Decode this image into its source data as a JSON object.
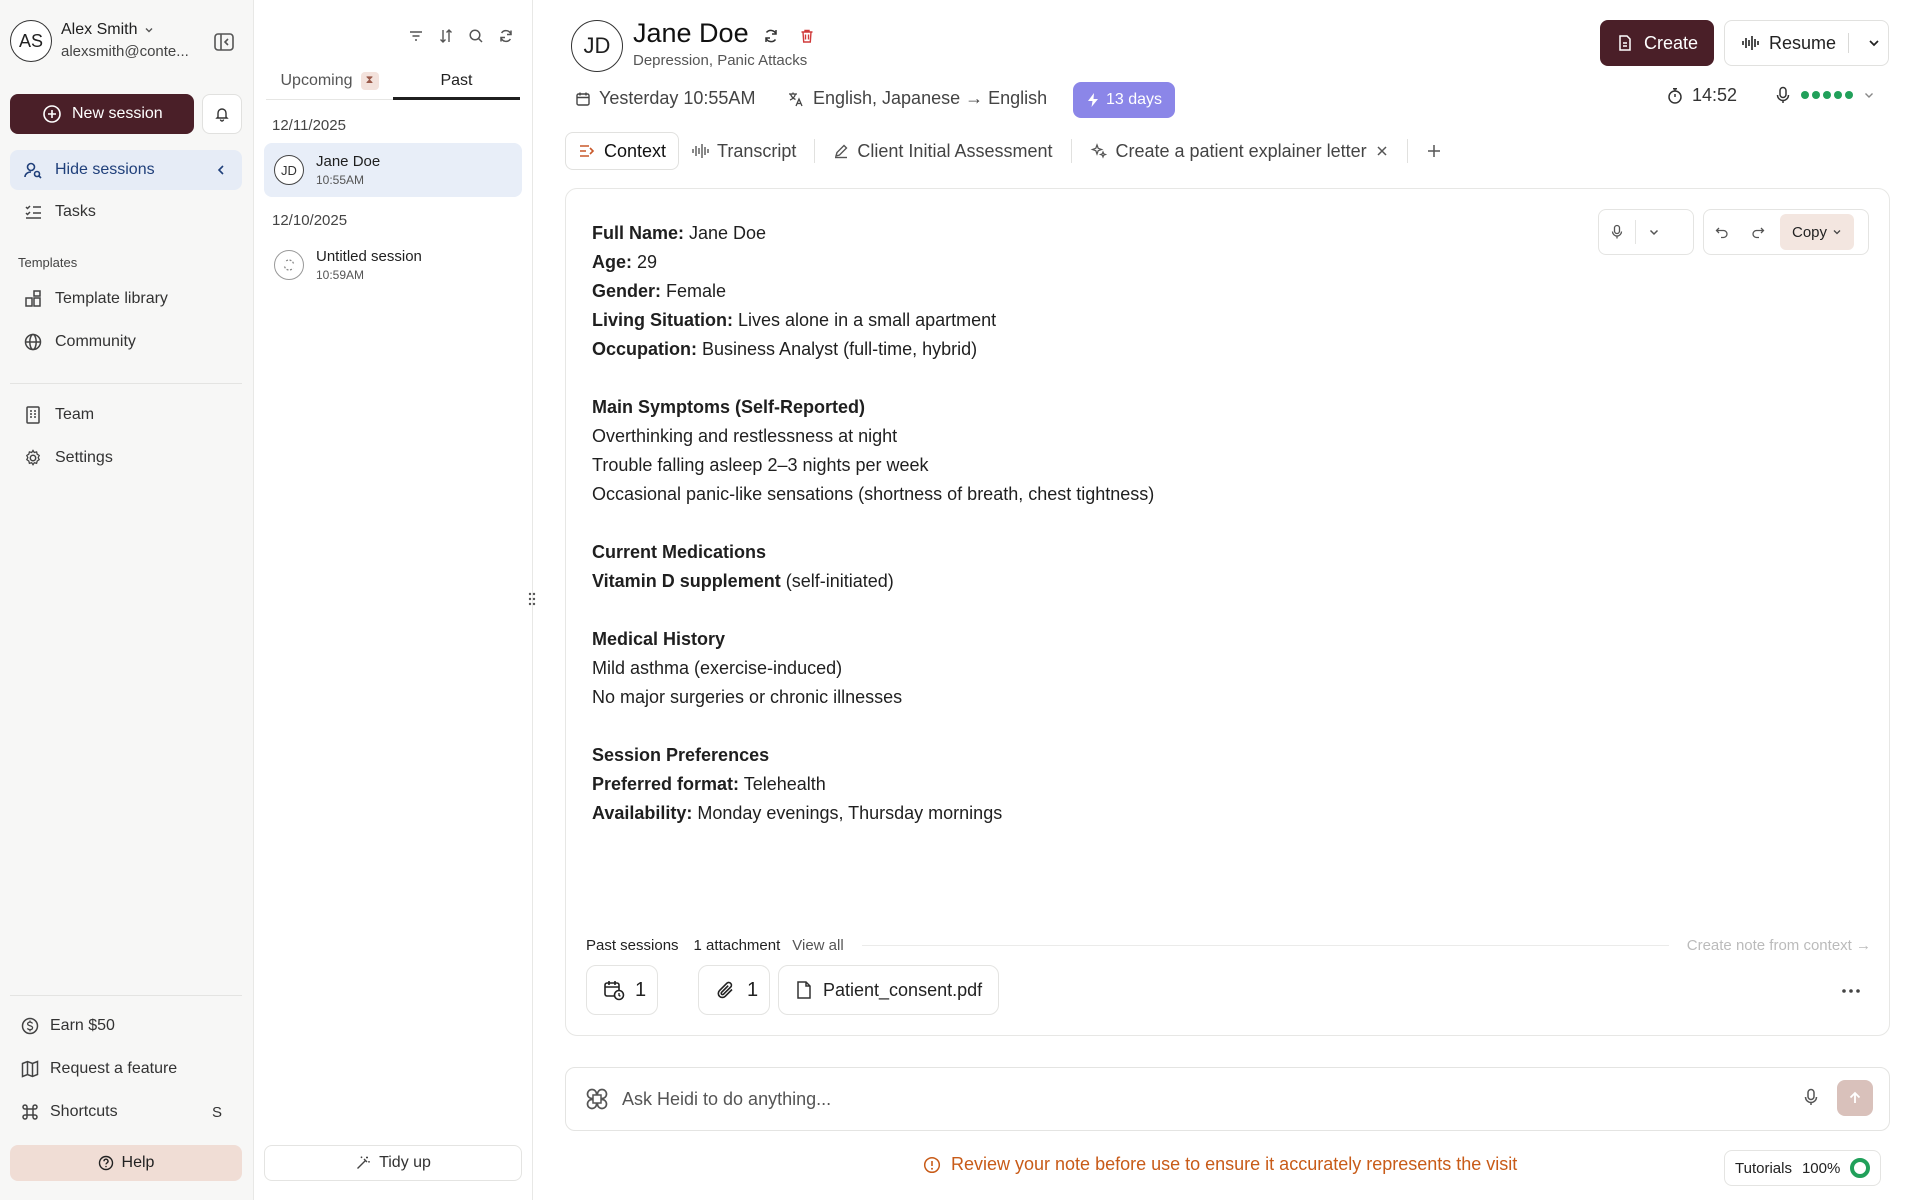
{
  "user": {
    "initials": "AS",
    "name": "Alex Smith",
    "email": "alexsmith@conte..."
  },
  "sidebar": {
    "new_session": "New session",
    "hide_sessions": "Hide sessions",
    "tasks": "Tasks",
    "templates_label": "Templates",
    "template_library": "Template library",
    "community": "Community",
    "team": "Team",
    "settings": "Settings",
    "earn": "Earn $50",
    "request_feature": "Request a feature",
    "shortcuts": "Shortcuts",
    "shortcuts_key": "S",
    "help": "Help"
  },
  "sessions": {
    "tabs": {
      "upcoming": "Upcoming",
      "upcoming_badge": "⧗",
      "past": "Past"
    },
    "groups": [
      {
        "date": "12/11/2025",
        "items": [
          {
            "initials": "JD",
            "name": "Jane Doe",
            "time": "10:55AM"
          }
        ]
      },
      {
        "date": "12/10/2025",
        "items": [
          {
            "name": "Untitled session",
            "time": "10:59AM"
          }
        ]
      }
    ],
    "tidy_up": "Tidy up"
  },
  "patient": {
    "initials": "JD",
    "name": "Jane Doe",
    "conditions": "Depression, Panic Attacks"
  },
  "header": {
    "create": "Create",
    "resume": "Resume",
    "date": "Yesterday 10:55AM",
    "languages": "English, Japanese → English",
    "days_badge": "13 days",
    "timer": "14:52"
  },
  "tabs": [
    {
      "label": "Context"
    },
    {
      "label": "Transcript"
    },
    {
      "label": "Client Initial Assessment"
    },
    {
      "label": "Create a patient explainer letter"
    }
  ],
  "toolbar": {
    "copy": "Copy"
  },
  "context_doc": {
    "full_name_label": "Full Name:",
    "full_name": " Jane Doe",
    "age_label": "Age:",
    "age": " 29",
    "gender_label": "Gender:",
    "gender": " Female",
    "living_label": "Living Situation:",
    "living": " Lives alone in a small apartment",
    "occupation_label": "Occupation:",
    "occupation": " Business Analyst (full-time, hybrid)",
    "symptoms_heading": "Main Symptoms (Self-Reported)",
    "symptoms": [
      "Overthinking and restlessness at night",
      "Trouble falling asleep 2–3 nights per week",
      "Occasional panic-like sensations (shortness of breath, chest tightness)"
    ],
    "meds_heading": "Current Medications",
    "meds_bold": "Vitamin D supplement",
    "meds_rest": " (self-initiated)",
    "history_heading": "Medical History",
    "history": [
      "Mild asthma (exercise-induced)",
      "No major surgeries or chronic illnesses"
    ],
    "prefs_heading": "Session Preferences",
    "format_label": "Preferred format:",
    "format": " Telehealth",
    "availability_label": "Availability:",
    "availability": " Monday evenings, Thursday mornings"
  },
  "footer": {
    "past_sessions": "Past sessions",
    "attachments": "1 attachment",
    "view_all": "View all",
    "create_note": "Create note from context →",
    "past_count": "1",
    "attach_count": "1",
    "file_name": "Patient_consent.pdf"
  },
  "ask": {
    "placeholder": "Ask Heidi to do anything..."
  },
  "warning": "Review your note before use to ensure it accurately represents the visit",
  "tutorials": {
    "label": "Tutorials",
    "progress": "100%"
  }
}
